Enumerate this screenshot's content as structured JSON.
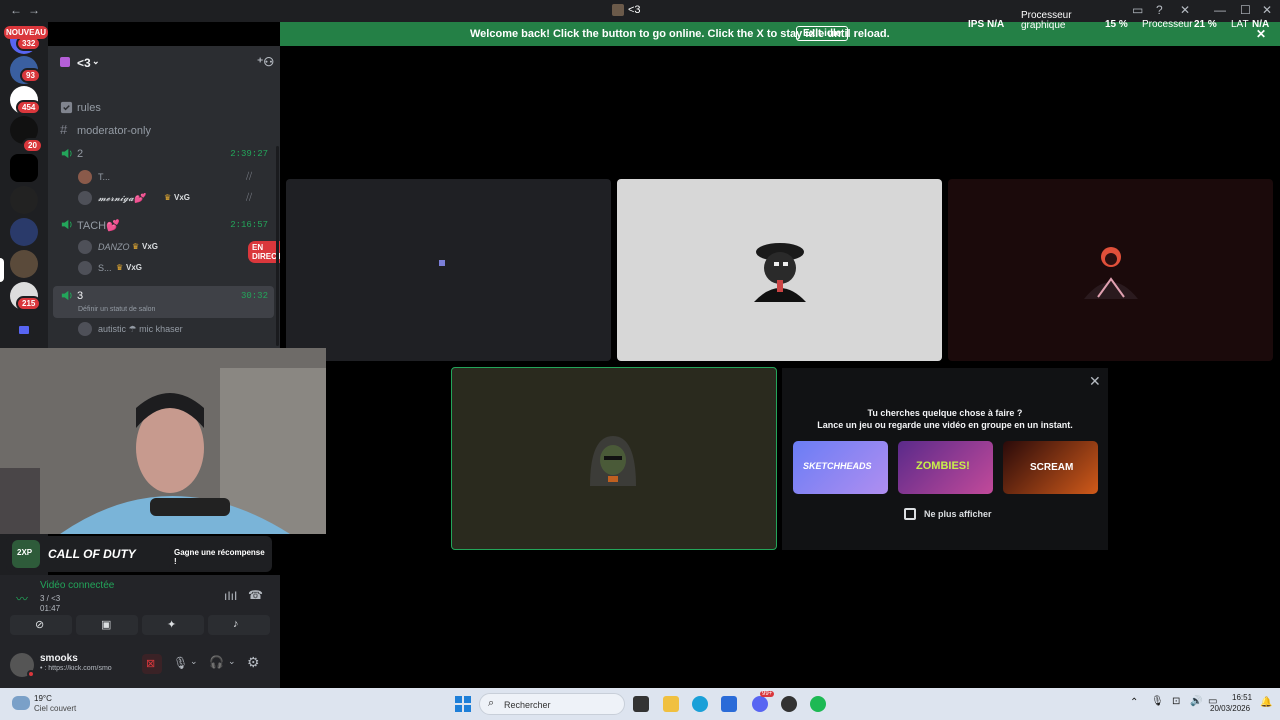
{
  "window": {
    "title": "<3"
  },
  "banner": {
    "message": "Welcome back! Click the button to go online. Click the X to stay idle until reload.",
    "button": "Exit idle"
  },
  "perf": {
    "ips_label": "IPS",
    "ips_value": "N/A",
    "gpu_label_1": "Processeur",
    "gpu_label_2": "graphique",
    "gpu_value": "15 %",
    "cpu_label": "Processeur",
    "cpu_value": "21 %",
    "lat_label": "LAT",
    "lat_value": "N/A"
  },
  "rail": {
    "nouveau": "NOUVEAU",
    "badges": [
      "332",
      "93",
      "454",
      "20",
      "215"
    ]
  },
  "server": {
    "name": "<3"
  },
  "channels": [
    {
      "type": "text",
      "name": "rules"
    },
    {
      "type": "text",
      "name": "moderator-only"
    },
    {
      "type": "voice",
      "name": "2",
      "time": "2:39:27"
    },
    {
      "type": "voice",
      "name": "TACH💕",
      "time": "2:16:57"
    },
    {
      "type": "voice",
      "name": "3",
      "time": "30:32",
      "status": "Définir un statut de salon"
    }
  ],
  "voice_users": {
    "c2": [
      "T...",
      "𝓶𝓮𝓻𝓷𝓲𝓰𝓪💕"
    ],
    "c2_tag": "VxG",
    "tach": [
      "DANZO",
      "S..."
    ],
    "tach_tag": "VxG",
    "live": "EN DIRECT",
    "c3": [
      "autistic ☂ mic khaser"
    ]
  },
  "promo": {
    "game": "CALL OF DUTY",
    "xp": "2XP",
    "button": "Gagne une récompense !"
  },
  "voice": {
    "status": "Vidéo connectée",
    "channel": "3 / <3",
    "timer": "01:47"
  },
  "user": {
    "name": "smooks",
    "status": "• : https://kick.com/smo"
  },
  "activity": {
    "title": "Tu cherches quelque chose à faire ?",
    "subtitle": "Lance un jeu ou regarde une vidéo en groupe en un instant.",
    "games": [
      "SKETCHHEADS",
      "ZOMBIES!",
      "SCREAM"
    ],
    "dont_show": "Ne plus afficher"
  },
  "taskbar": {
    "weather_temp": "19°C",
    "weather_desc": "Ciel couvert",
    "search": "Rechercher",
    "time": "16:51",
    "date": "20/03/2026",
    "discord_badge": "99+"
  },
  "colors": {
    "accent": "#248046",
    "danger": "#da373c",
    "voice": "#23a55a",
    "bg": "#000000",
    "sidebar": "#2b2d31"
  }
}
